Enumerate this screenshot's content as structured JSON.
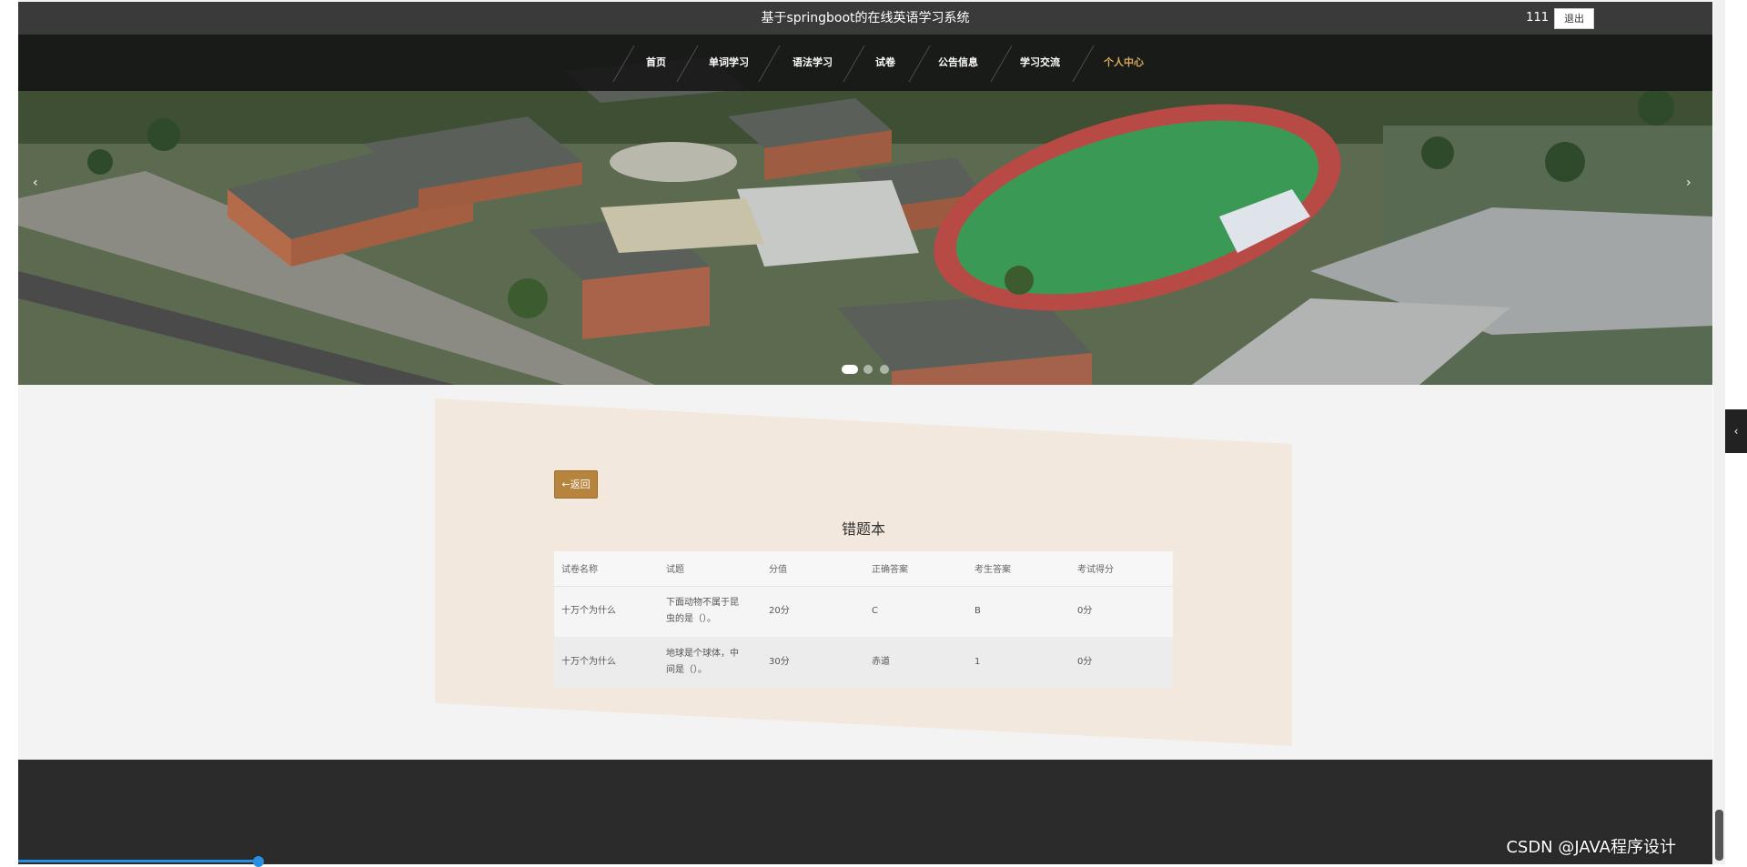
{
  "header": {
    "site_title": "基于springboot的在线英语学习系统",
    "username": "111",
    "logout_label": "退出"
  },
  "nav": {
    "items": [
      {
        "label": "首页"
      },
      {
        "label": "单词学习"
      },
      {
        "label": "语法学习"
      },
      {
        "label": "试卷"
      },
      {
        "label": "公告信息"
      },
      {
        "label": "学习交流"
      },
      {
        "label": "个人中心"
      }
    ],
    "active_index": 6,
    "active_color": "#d9a85a"
  },
  "carousel": {
    "prev_icon": "‹",
    "next_icon": "›",
    "slide_count": 3,
    "active_slide": 1
  },
  "content": {
    "back_label": "←返回",
    "title": "错题本",
    "columns": [
      "试卷名称",
      "试题",
      "分值",
      "正确答案",
      "考生答案",
      "考试得分"
    ],
    "rows": [
      [
        "十万个为什么",
        "下面动物不属于昆虫的是（）。",
        "20分",
        "C",
        "B",
        "0分"
      ],
      [
        "十万个为什么",
        "地球是个球体，中间是（）。",
        "30分",
        "赤道",
        "1",
        "0分"
      ]
    ]
  },
  "watermark": "CSDN @JAVA程序设计",
  "colors": {
    "accent": "#b6843c",
    "topbar": "#3a3a3a",
    "footer": "#2b2b2b",
    "content_panel": "#f2e8dd"
  }
}
